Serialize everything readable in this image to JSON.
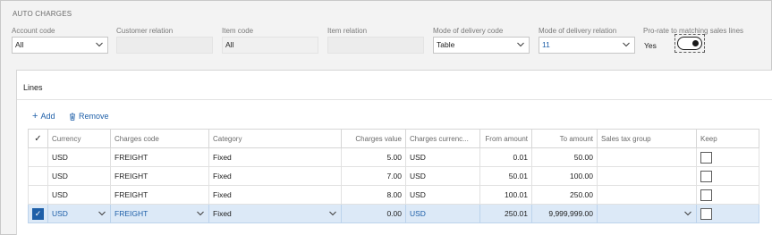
{
  "section": {
    "title": "AUTO CHARGES"
  },
  "fields": {
    "account_code": {
      "label": "Account code",
      "value": "All"
    },
    "customer_relation": {
      "label": "Customer relation",
      "value": ""
    },
    "item_code": {
      "label": "Item code",
      "value": "All"
    },
    "item_relation": {
      "label": "Item relation",
      "value": ""
    },
    "mode_delivery_code": {
      "label": "Mode of delivery code",
      "value": "Table"
    },
    "mode_delivery_relation": {
      "label": "Mode of delivery relation",
      "value": "11"
    },
    "prorate": {
      "label": "Pro-rate to matching sales lines",
      "value": "Yes",
      "on": true
    }
  },
  "lines": {
    "title": "Lines",
    "add_label": "Add",
    "remove_label": "Remove",
    "columns": [
      "Currency",
      "Charges code",
      "Category",
      "Charges value",
      "Charges currenc...",
      "From amount",
      "To amount",
      "Sales tax group",
      "Keep"
    ],
    "rows": [
      {
        "currency": "USD",
        "charges_code": "FREIGHT",
        "category": "Fixed",
        "charges_value": "5.00",
        "charges_currency": "USD",
        "from_amount": "0.01",
        "to_amount": "50.00",
        "sales_tax_group": "",
        "keep": false,
        "selected": false
      },
      {
        "currency": "USD",
        "charges_code": "FREIGHT",
        "category": "Fixed",
        "charges_value": "7.00",
        "charges_currency": "USD",
        "from_amount": "50.01",
        "to_amount": "100.00",
        "sales_tax_group": "",
        "keep": false,
        "selected": false
      },
      {
        "currency": "USD",
        "charges_code": "FREIGHT",
        "category": "Fixed",
        "charges_value": "8.00",
        "charges_currency": "USD",
        "from_amount": "100.01",
        "to_amount": "250.00",
        "sales_tax_group": "",
        "keep": false,
        "selected": false
      },
      {
        "currency": "USD",
        "charges_code": "FREIGHT",
        "category": "Fixed",
        "charges_value": "0.00",
        "charges_currency": "USD",
        "from_amount": "250.01",
        "to_amount": "9,999,999.00",
        "sales_tax_group": "",
        "keep": false,
        "selected": true
      }
    ]
  },
  "colors": {
    "accent": "#1e5fa8",
    "selected_row": "#dce9f7",
    "background": "#f3f3f3"
  }
}
